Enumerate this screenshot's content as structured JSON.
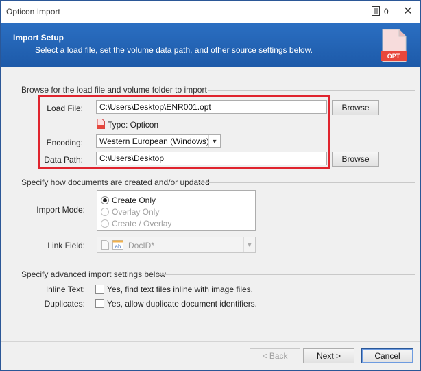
{
  "window": {
    "title": "Opticon Import",
    "notes_count": "0"
  },
  "header": {
    "title": "Import Setup",
    "subtitle": "Select a load file, set the volume data path, and other source settings below.",
    "icon_label": "OPT"
  },
  "browse_section": {
    "heading": "Browse for the load file and volume folder to import",
    "load_file_label": "Load File:",
    "load_file_value": "C:\\Users\\Desktop\\ENR001.opt",
    "load_file_browse": "Browse",
    "type_text": "Type: Opticon",
    "encoding_label": "Encoding:",
    "encoding_value": "Western European (Windows)",
    "data_path_label": "Data Path:",
    "data_path_value": "C:\\Users\\Desktop",
    "data_path_browse": "Browse"
  },
  "documents_section": {
    "heading": "Specify how documents are created and/or updated",
    "import_mode_label": "Import Mode:",
    "import_modes": [
      {
        "label": "Create Only",
        "selected": true,
        "enabled": true
      },
      {
        "label": "Overlay Only",
        "selected": false,
        "enabled": false
      },
      {
        "label": "Create / Overlay",
        "selected": false,
        "enabled": false
      }
    ],
    "link_field_label": "Link Field:",
    "link_field_value": "DocID*"
  },
  "advanced_section": {
    "heading": "Specify advanced import settings below",
    "inline_text_label": "Inline Text:",
    "inline_text_option": "Yes, find text files inline with image files.",
    "duplicates_label": "Duplicates:",
    "duplicates_option": "Yes, allow duplicate document identifiers."
  },
  "footer": {
    "back_label": "< Back",
    "next_label": "Next >",
    "cancel_label": "Cancel"
  },
  "colors": {
    "header_blue": "#2264b4",
    "highlight_red": "#e0242e",
    "opt_red": "#e8473c"
  }
}
